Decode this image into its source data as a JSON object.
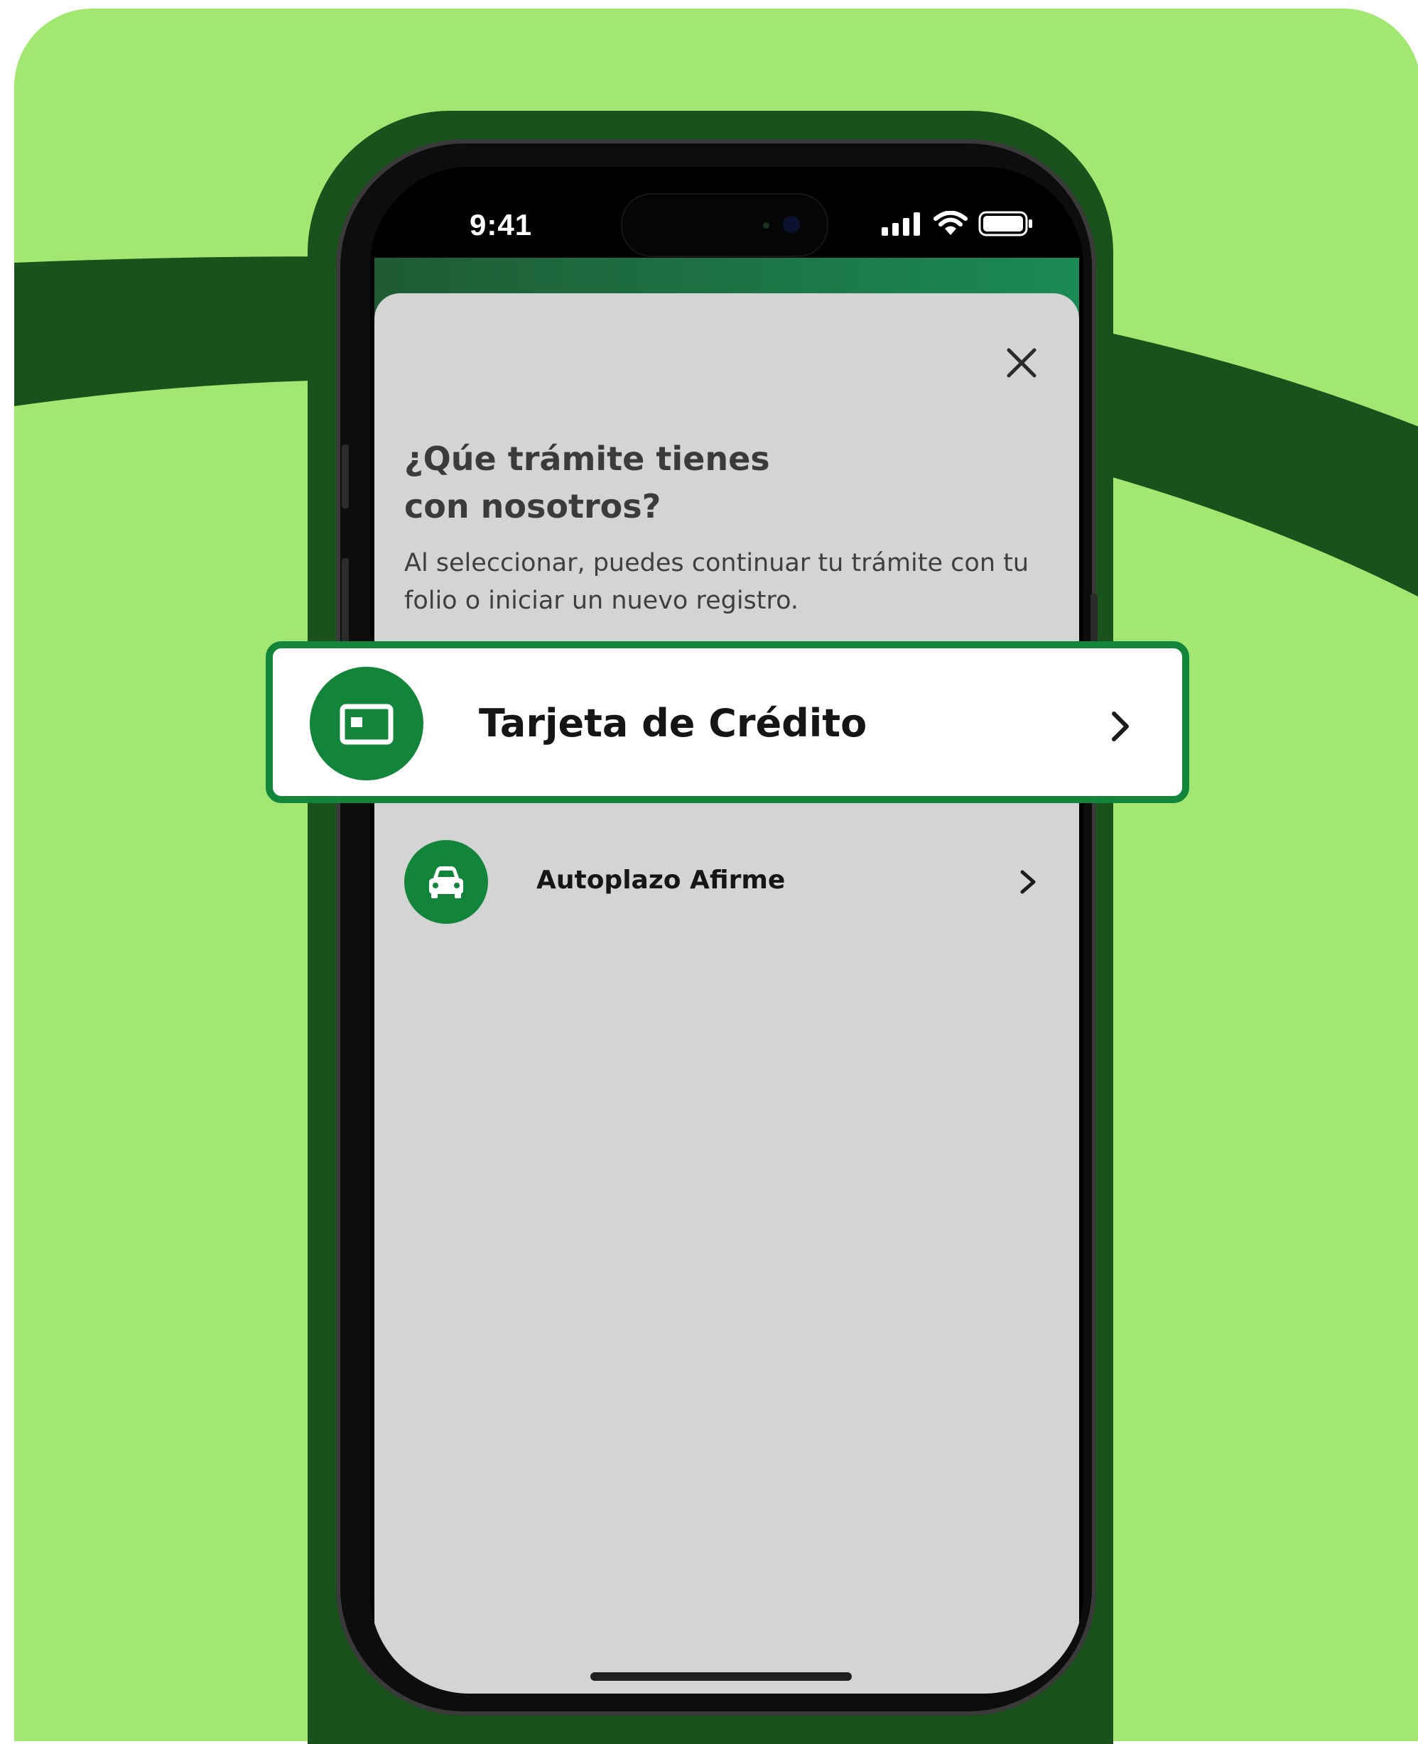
{
  "colors": {
    "background": "#a2e772",
    "dark_green": "#1a521b",
    "brand_green": "#13853a",
    "sheet_gray": "#d4d4d4"
  },
  "status_bar": {
    "time": "9:41",
    "icons": [
      "signal-icon",
      "wifi-icon",
      "battery-icon"
    ]
  },
  "sheet": {
    "close_icon": "close-icon",
    "title_line1": "¿Qúe trámite tienes",
    "title_line2": "con nosotros?",
    "description_line1": "Al seleccionar, puedes continuar tu trámite con tu",
    "description_line2": "folio o iniciar un nuevo registro.",
    "options": [
      {
        "label": "Tarjeta de Crédito",
        "icon": "credit-card-icon",
        "highlighted": true
      },
      {
        "label": "Autoplazo Afirme",
        "icon": "car-icon",
        "highlighted": false
      }
    ]
  }
}
